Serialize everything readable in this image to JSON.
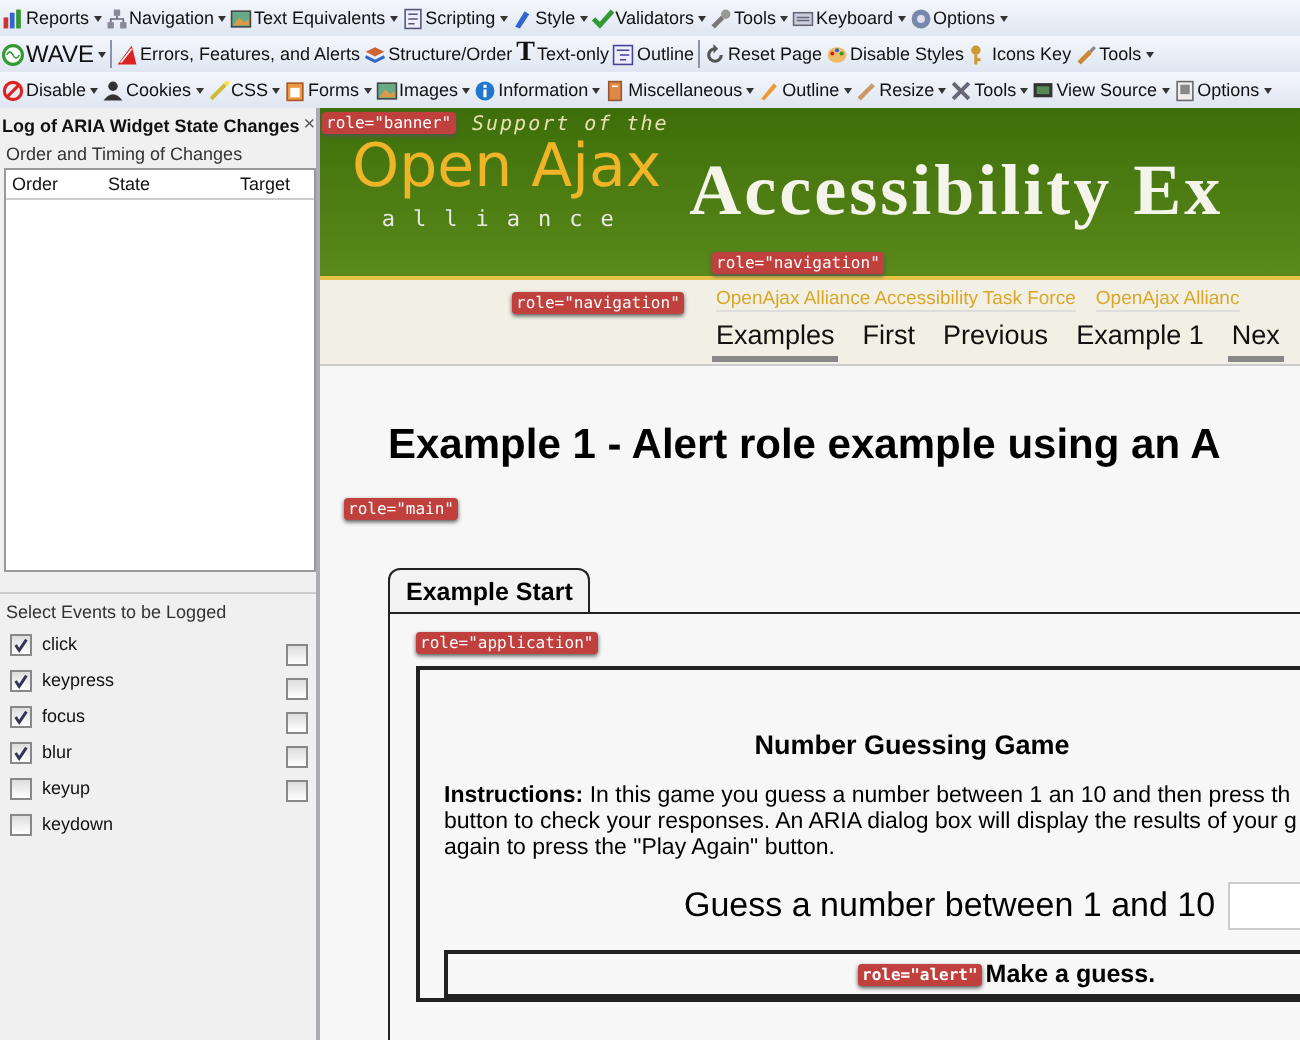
{
  "toolbars": [
    {
      "items": [
        {
          "kind": "menu",
          "label": "Reports",
          "dropdown": true
        },
        {
          "kind": "menu",
          "label": "Navigation",
          "dropdown": true
        },
        {
          "kind": "menu",
          "label": "Text Equivalents",
          "dropdown": true
        },
        {
          "kind": "menu",
          "label": "Scripting",
          "dropdown": true
        },
        {
          "kind": "menu",
          "label": "Style",
          "dropdown": true
        },
        {
          "kind": "menu",
          "label": "Validators",
          "dropdown": true
        },
        {
          "kind": "menu",
          "label": "Tools",
          "dropdown": true
        },
        {
          "kind": "menu",
          "label": "Keyboard",
          "dropdown": true
        },
        {
          "kind": "menu",
          "label": "Options",
          "dropdown": true
        }
      ]
    },
    {
      "items": [
        {
          "kind": "brand",
          "label": "WAVE",
          "dropdown": true
        },
        {
          "kind": "separator"
        },
        {
          "kind": "menu",
          "label": "Errors, Features, and Alerts",
          "dropdown": false
        },
        {
          "kind": "menu",
          "label": "Structure/Order",
          "dropdown": false
        },
        {
          "kind": "glyph",
          "glyph": "T",
          "label": "Text-only",
          "dropdown": false
        },
        {
          "kind": "menu",
          "label": "Outline",
          "dropdown": false
        },
        {
          "kind": "separator"
        },
        {
          "kind": "menu",
          "label": "Reset Page",
          "dropdown": false
        },
        {
          "kind": "menu",
          "label": "Disable Styles",
          "dropdown": false
        },
        {
          "kind": "menu",
          "label": "Icons Key",
          "dropdown": false
        },
        {
          "kind": "menu",
          "label": "Tools",
          "dropdown": true
        }
      ]
    },
    {
      "items": [
        {
          "kind": "menu",
          "label": "Disable",
          "dropdown": true
        },
        {
          "kind": "menu",
          "label": "Cookies",
          "dropdown": true
        },
        {
          "kind": "menu",
          "label": "CSS",
          "dropdown": true
        },
        {
          "kind": "menu",
          "label": "Forms",
          "dropdown": true
        },
        {
          "kind": "menu",
          "label": "Images",
          "dropdown": true
        },
        {
          "kind": "menu",
          "label": "Information",
          "dropdown": true
        },
        {
          "kind": "menu",
          "label": "Miscellaneous",
          "dropdown": true
        },
        {
          "kind": "menu",
          "label": "Outline",
          "dropdown": true
        },
        {
          "kind": "menu",
          "label": "Resize",
          "dropdown": true
        },
        {
          "kind": "menu",
          "label": "Tools",
          "dropdown": true
        },
        {
          "kind": "menu",
          "label": "View Source",
          "dropdown": true
        },
        {
          "kind": "menu",
          "label": "Options",
          "dropdown": true
        }
      ]
    }
  ],
  "sidebar": {
    "title": "Log of ARIA Widget State Changes",
    "close": "×",
    "log": {
      "legend": "Order and Timing of Changes",
      "columns": [
        "Order",
        "State",
        "Target"
      ]
    },
    "events": {
      "legend": "Select Events to be Logged",
      "options": [
        {
          "label": "click",
          "checked": true
        },
        {
          "label": "keypress",
          "checked": true
        },
        {
          "label": "focus",
          "checked": true
        },
        {
          "label": "blur",
          "checked": true
        },
        {
          "label": "keyup",
          "checked": false
        },
        {
          "label": "keydown",
          "checked": false
        }
      ],
      "extra_options": [
        {
          "checked": false
        },
        {
          "checked": false
        },
        {
          "checked": false
        },
        {
          "checked": false
        },
        {
          "checked": false
        }
      ]
    }
  },
  "page": {
    "banner": {
      "tagline": "Support of the",
      "logo_top": "Open Ajax",
      "logo_bottom": "alliance",
      "title": "Accessibility Ex"
    },
    "links": [
      "OpenAjax Alliance Accessibility Task Force",
      "OpenAjax Allianc"
    ],
    "nav": [
      {
        "label": "Examples",
        "selected": true
      },
      {
        "label": "First",
        "selected": false
      },
      {
        "label": "Previous",
        "selected": false
      },
      {
        "label": "Example 1",
        "selected": false
      },
      {
        "label": "Nex",
        "selected": true
      }
    ],
    "heading": "Example 1 - Alert role example using an A",
    "tab": "Example Start",
    "game": {
      "title": "Number Guessing Game",
      "instructions": [
        "**Instructions:** In this game you guess a number between 1 an 10 and then press th",
        "button to check your responses. An ARIA dialog box will display the results of your g",
        "again to press the \"Play Again\" button."
      ],
      "prompt": "Guess a number between 1 and 10",
      "alert": "Make a guess."
    },
    "role_tags": [
      "role=\"banner\"",
      "role=\"navigation\"",
      "role=\"navigation\"",
      "role=\"main\"",
      "role=\"application\"",
      "role=\"alert\""
    ]
  }
}
